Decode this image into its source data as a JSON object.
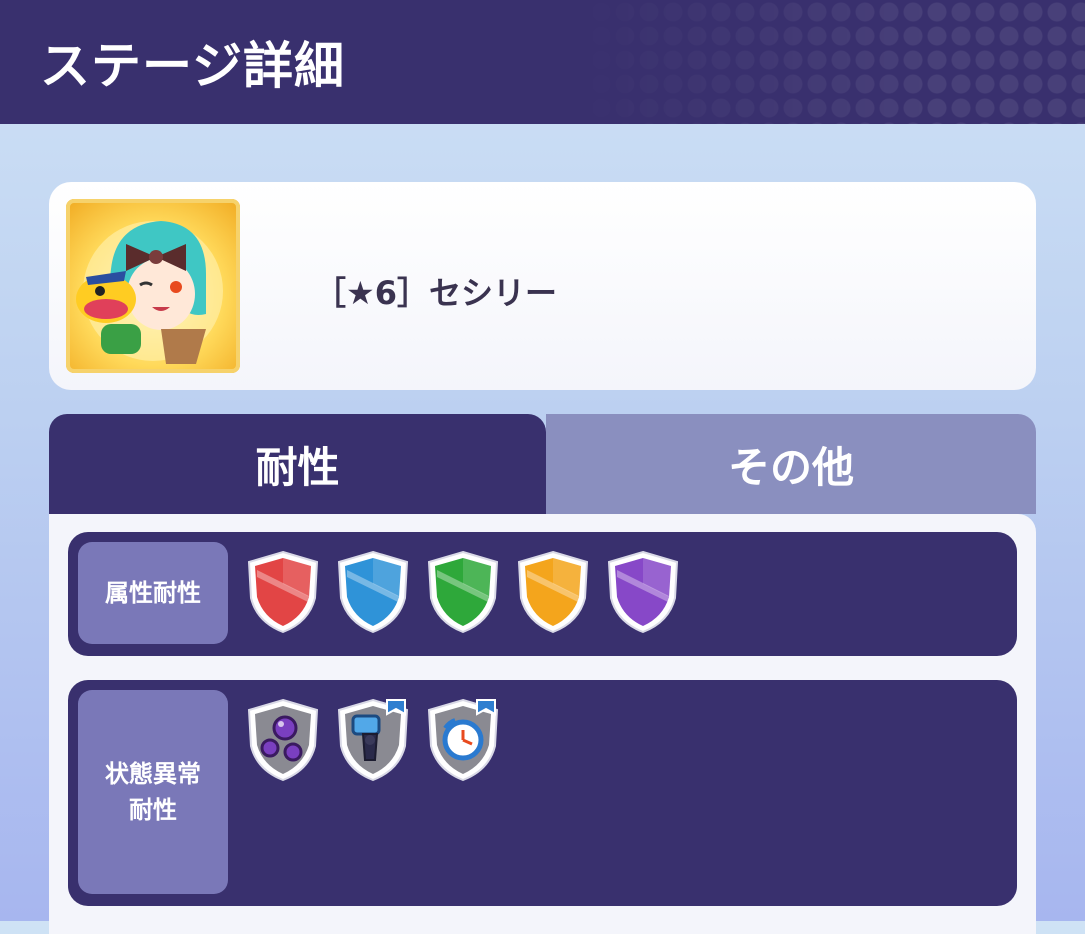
{
  "header": {
    "title": "ステージ詳細"
  },
  "stage": {
    "name": "［★6］セシリー"
  },
  "tabs": [
    {
      "label": "耐性",
      "active": true
    },
    {
      "label": "その他",
      "active": false
    }
  ],
  "resistances": {
    "attribute": {
      "label": "属性耐性",
      "icons": [
        "red-shield-icon",
        "blue-shield-icon",
        "green-shield-icon",
        "yellow-shield-icon",
        "purple-shield-icon"
      ]
    },
    "status": {
      "label_line1": "状態異常",
      "label_line2": "耐性",
      "icons": [
        "poison-orbs-shield-icon",
        "bind-fist-shield-icon",
        "clock-shield-icon"
      ]
    }
  },
  "colors": {
    "header": "#39306e",
    "tab_inactive": "#8a8fbf",
    "label_bg": "#7a78b8"
  }
}
